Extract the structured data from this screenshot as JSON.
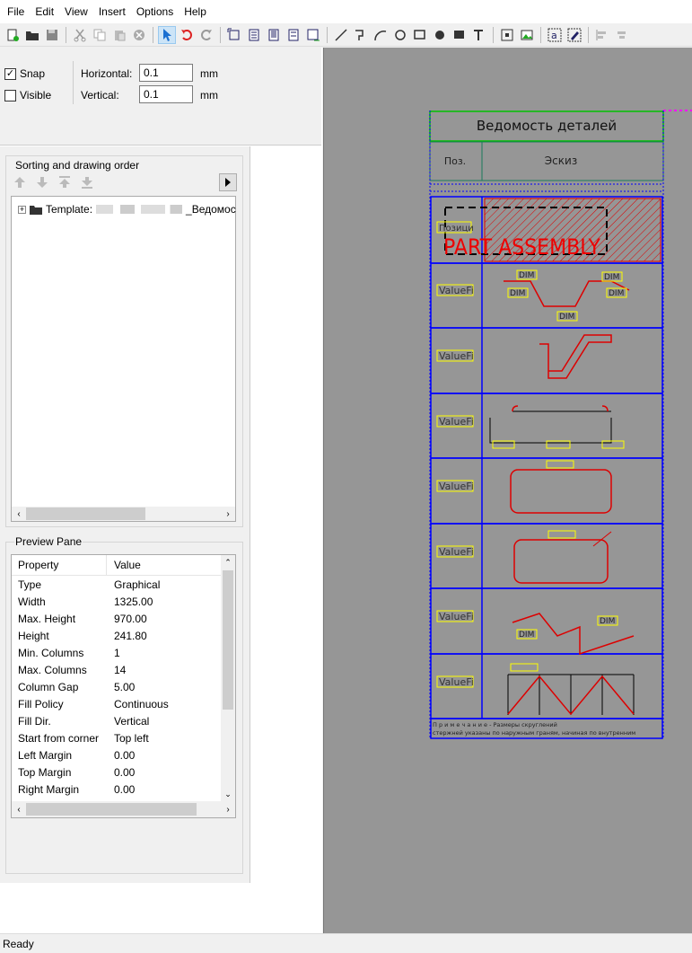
{
  "menu": [
    "File",
    "Edit",
    "View",
    "Insert",
    "Options",
    "Help"
  ],
  "snap": {
    "snap_label": "Snap",
    "snap_checked": true,
    "visible_label": "Visible",
    "visible_checked": false,
    "horizontal_label": "Horizontal:",
    "horizontal_value": "0.1",
    "horizontal_unit": "mm",
    "vertical_label": "Vertical:",
    "vertical_value": "0.1",
    "vertical_unit": "mm"
  },
  "sorting": {
    "title": "Sorting and drawing order",
    "tree_item_prefix": "Template:",
    "tree_item_suffix": "_Ведомос"
  },
  "preview": {
    "title": "Preview Pane",
    "col_property": "Property",
    "col_value": "Value",
    "rows": [
      {
        "k": "Type",
        "v": "Graphical"
      },
      {
        "k": "Width",
        "v": "1325.00"
      },
      {
        "k": "Max. Height",
        "v": "970.00"
      },
      {
        "k": "Height",
        "v": "241.80"
      },
      {
        "k": "Min. Columns",
        "v": "1"
      },
      {
        "k": "Max. Columns",
        "v": "14"
      },
      {
        "k": "Column Gap",
        "v": "5.00"
      },
      {
        "k": "Fill Policy",
        "v": "Continuous"
      },
      {
        "k": "Fill Dir.",
        "v": "Vertical"
      },
      {
        "k": "Start from corner",
        "v": "Top left"
      },
      {
        "k": "Left Margin",
        "v": "0.00"
      },
      {
        "k": "Top Margin",
        "v": "0.00"
      },
      {
        "k": "Right Margin",
        "v": "0.00"
      }
    ]
  },
  "sheet": {
    "title": "Ведомость деталей",
    "col_pos": "Поз.",
    "col_sketch": "Эскиз",
    "row1_pos": "Позици",
    "part_assembly": "PART ASSEMBLY",
    "value_label": "ValueFi",
    "note_line1": "П р и м е ч а н и е - Размеры скруглений",
    "note_line2": "стержней указаны по наружным граням, начиная по внутренним",
    "dim_label": "DIM"
  },
  "status": "Ready",
  "colors": {
    "accent": "#0000ff",
    "green": "#00c000",
    "red": "#ff0000",
    "canvas": "#969696",
    "label_bg": "#ffff00"
  }
}
